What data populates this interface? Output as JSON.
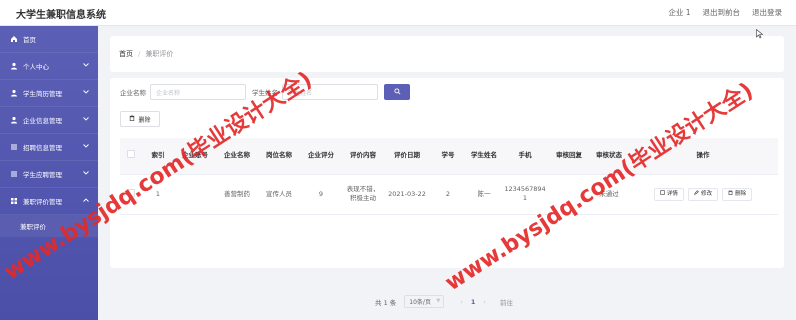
{
  "app": {
    "title": "大学生兼职信息系统"
  },
  "topbar": {
    "links": [
      "企业 1",
      "退出到前台",
      "退出登录"
    ]
  },
  "sidebar": {
    "items": [
      {
        "label": "首页",
        "icon": "home-icon",
        "expandable": false
      },
      {
        "label": "个人中心",
        "icon": "user-icon",
        "expandable": true
      },
      {
        "label": "学生简历管理",
        "icon": "user-icon",
        "expandable": true
      },
      {
        "label": "企业信息管理",
        "icon": "user-icon",
        "expandable": true
      },
      {
        "label": "招聘信息管理",
        "icon": "menu-icon",
        "expandable": true
      },
      {
        "label": "学生应聘管理",
        "icon": "menu-icon",
        "expandable": true
      },
      {
        "label": "兼职评价管理",
        "icon": "grid-icon",
        "expandable": true
      }
    ],
    "sub_item": "兼职评价"
  },
  "breadcrumb": {
    "home": "首页",
    "current": "兼职评价"
  },
  "search": {
    "company_label": "企业名称",
    "company_placeholder": "企业名称",
    "student_label": "学生姓名",
    "student_placeholder": "学生姓名"
  },
  "toolbar": {
    "delete_label": "删除"
  },
  "table": {
    "headers": [
      "",
      "索引",
      "企业账号",
      "企业名称",
      "岗位名称",
      "企业评分",
      "评价内容",
      "评价日期",
      "学号",
      "学生姓名",
      "手机",
      "审核回复",
      "审核状态",
      "操作"
    ],
    "rows": [
      {
        "index": "1",
        "company_account": "",
        "company_name": "善营制药",
        "position": "宣传人员",
        "score": "9",
        "content": "表现不错，积极主动",
        "date": "2021-03-22",
        "student_no": "2",
        "student_name": "陈一",
        "phone": "12345678941",
        "reply": "",
        "status": "未通过",
        "actions": [
          "详情",
          "修改",
          "删除"
        ]
      }
    ]
  },
  "pagination": {
    "total": "共 1 条",
    "page_size": "10条/页",
    "current_page": "1",
    "goto": "前往"
  },
  "watermark": {
    "text": "www.bysjdq.com(毕业设计大全)",
    "text2": "www.bysjdq.com(毕业设计大全)",
    "color": "#e42929"
  },
  "theme": {
    "accent": "#5b5fb5"
  }
}
